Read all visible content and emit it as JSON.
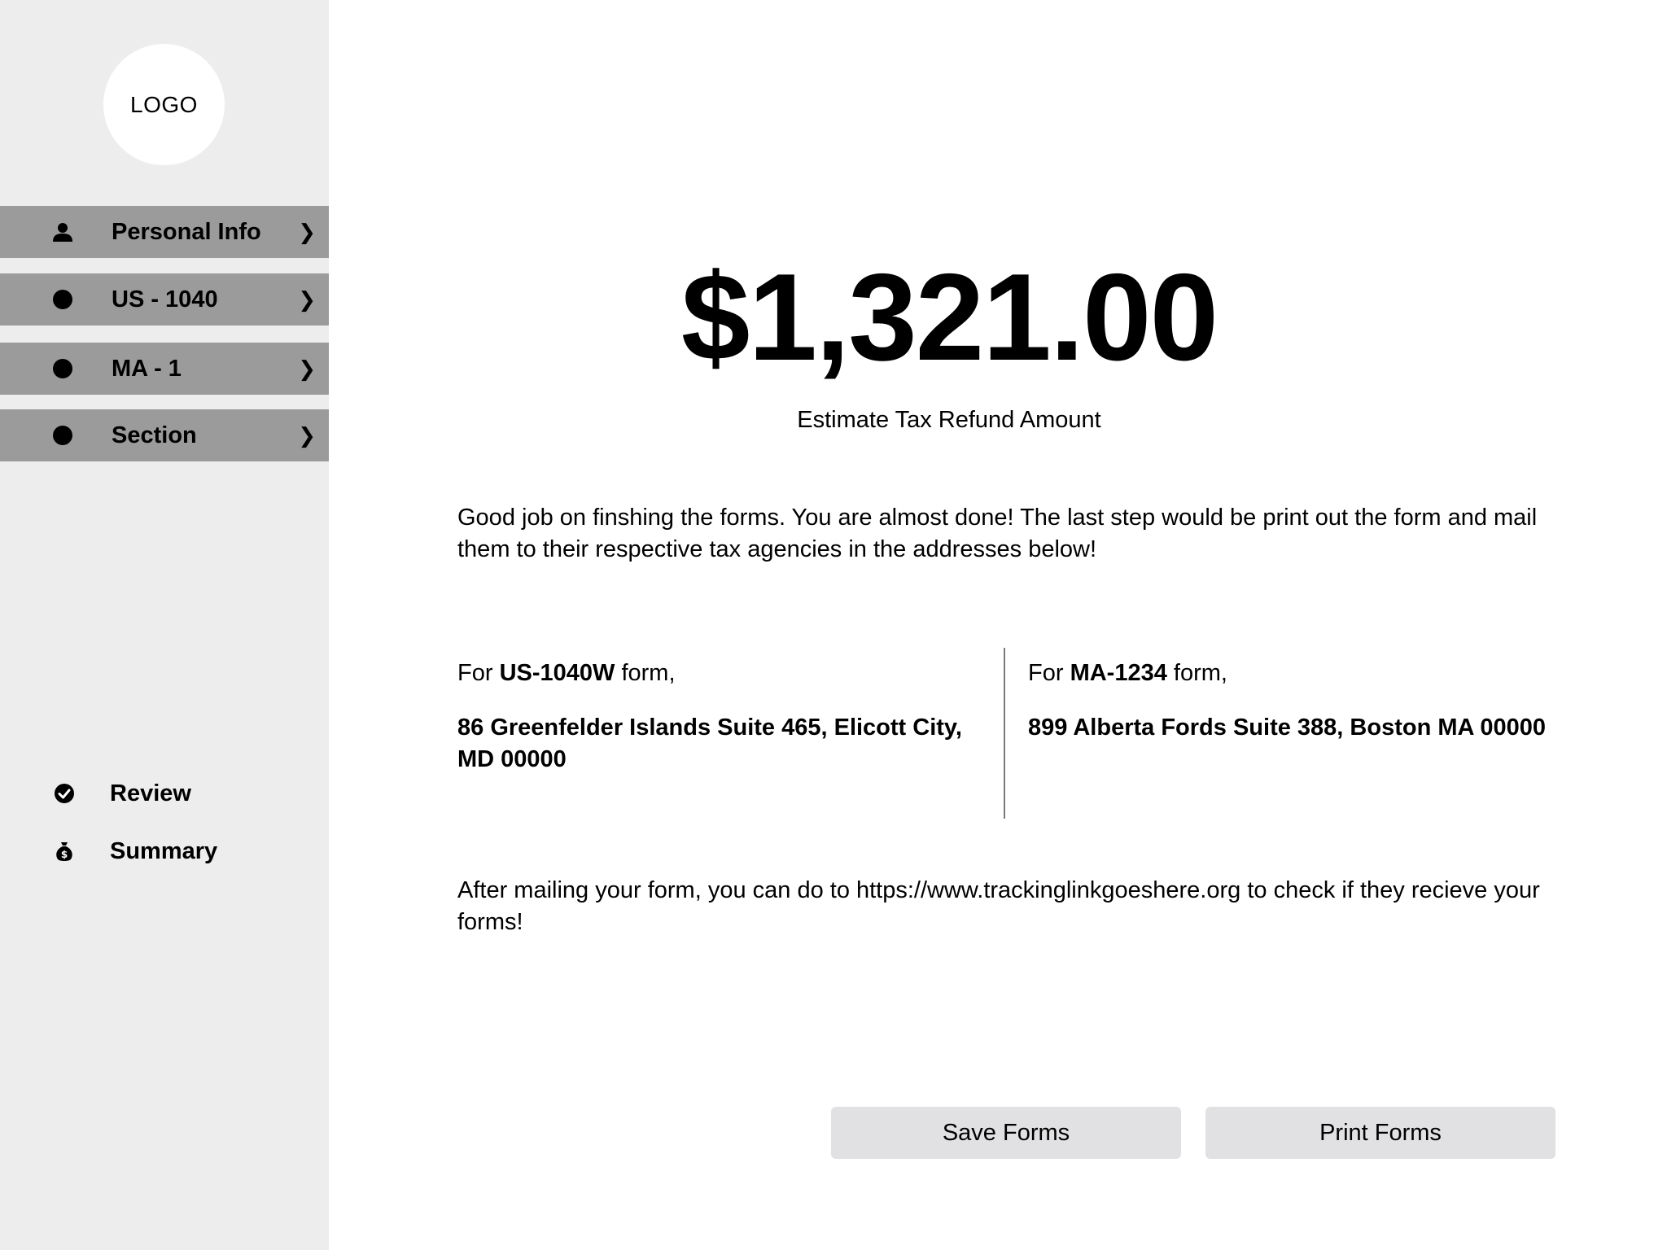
{
  "sidebar": {
    "logo": "LOGO",
    "nav": [
      {
        "label": "Personal Info",
        "icon": "person-icon",
        "chevron": "❯"
      },
      {
        "label": "US - 1040",
        "icon": "dot-icon",
        "chevron": "❯"
      },
      {
        "label": "MA - 1",
        "icon": "dot-icon",
        "chevron": "❯"
      },
      {
        "label": "Section",
        "icon": "dot-icon",
        "chevron": "❯"
      }
    ],
    "bottom": [
      {
        "label": "Review",
        "icon": "check-badge-icon"
      },
      {
        "label": "Summary",
        "icon": "money-bag-icon"
      }
    ]
  },
  "main": {
    "amount": "$1,321.00",
    "amount_label": "Estimate Tax Refund Amount",
    "intro": "Good job on finshing the forms. You are almost done! The last step would be print out the form and mail them to their respective tax agencies in the addresses below!",
    "left_form": {
      "prefix": "For ",
      "form_name": "US-1040W",
      "suffix": " form,",
      "address": "86 Greenfelder Islands Suite 465, Elicott City, MD 00000"
    },
    "right_form": {
      "prefix": "For ",
      "form_name": "MA-1234",
      "suffix": " form,",
      "address": "899 Alberta Fords Suite 388, Boston MA 00000"
    },
    "tracking": "After mailing your form, you can do to https://www.trackinglinkgoeshere.org to check if they recieve your forms!",
    "buttons": {
      "save": "Save Forms",
      "print": "Print Forms"
    }
  }
}
